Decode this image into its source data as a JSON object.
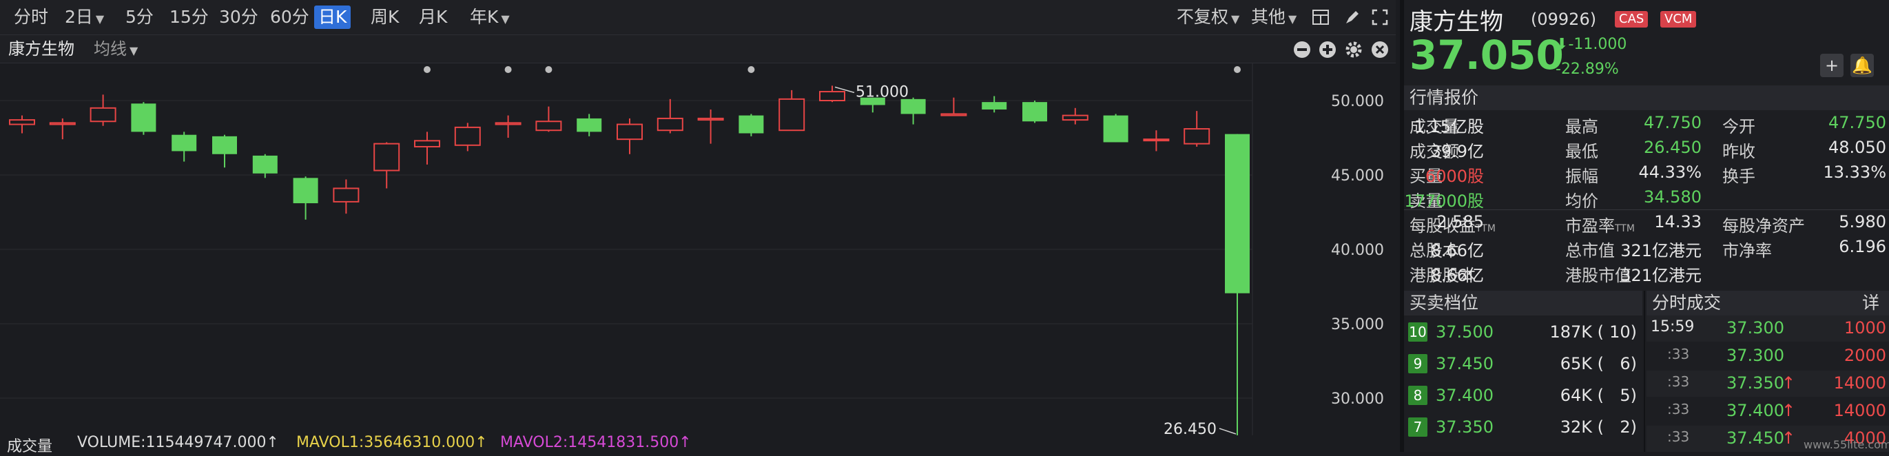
{
  "toolbar": {
    "periods": [
      "分时",
      "2日",
      "5分",
      "15分",
      "30分",
      "60分",
      "日K",
      "周K",
      "月K",
      "年K"
    ],
    "active_period": "日K",
    "adjust": "不复权",
    "other": "其他"
  },
  "subbar": {
    "name": "康方生物",
    "ma_label": "均线"
  },
  "chart_data": {
    "type": "candlestick",
    "ylim": [
      27.5,
      52.5
    ],
    "yticks": [
      "50.000",
      "45.000",
      "40.000",
      "35.000",
      "30.000"
    ],
    "annotations": {
      "high_label": "51.000",
      "low_label": "26.450"
    },
    "candles": [
      {
        "o": 48.4,
        "c": 48.7,
        "h": 49.0,
        "l": 47.8
      },
      {
        "o": 48.4,
        "c": 48.5,
        "h": 48.8,
        "l": 47.4
      },
      {
        "o": 48.6,
        "c": 49.5,
        "h": 50.4,
        "l": 48.3
      },
      {
        "o": 49.8,
        "c": 47.9,
        "h": 49.9,
        "l": 47.7
      },
      {
        "o": 47.7,
        "c": 46.6,
        "h": 47.9,
        "l": 45.9
      },
      {
        "o": 47.6,
        "c": 46.4,
        "h": 47.7,
        "l": 45.5
      },
      {
        "o": 46.3,
        "c": 45.1,
        "h": 46.4,
        "l": 44.8
      },
      {
        "o": 44.8,
        "c": 43.1,
        "h": 44.9,
        "l": 42.0
      },
      {
        "o": 43.2,
        "c": 44.1,
        "h": 44.7,
        "l": 42.4
      },
      {
        "o": 45.3,
        "c": 47.1,
        "h": 47.2,
        "l": 44.1
      },
      {
        "o": 46.9,
        "c": 47.3,
        "h": 47.9,
        "l": 45.7
      },
      {
        "o": 47.0,
        "c": 48.2,
        "h": 48.5,
        "l": 46.6
      },
      {
        "o": 48.4,
        "c": 48.5,
        "h": 49.0,
        "l": 47.5
      },
      {
        "o": 48.0,
        "c": 48.6,
        "h": 49.6,
        "l": 47.9
      },
      {
        "o": 48.8,
        "c": 47.9,
        "h": 49.1,
        "l": 47.6
      },
      {
        "o": 47.4,
        "c": 48.4,
        "h": 48.8,
        "l": 46.4
      },
      {
        "o": 48.0,
        "c": 48.8,
        "h": 50.1,
        "l": 47.8
      },
      {
        "o": 48.7,
        "c": 48.8,
        "h": 49.4,
        "l": 47.1
      },
      {
        "o": 49.0,
        "c": 47.8,
        "h": 49.1,
        "l": 47.6
      },
      {
        "o": 48.0,
        "c": 50.1,
        "h": 50.7,
        "l": 48.0
      },
      {
        "o": 50.0,
        "c": 50.6,
        "h": 51.0,
        "l": 49.9
      },
      {
        "o": 50.2,
        "c": 49.7,
        "h": 50.2,
        "l": 49.2
      },
      {
        "o": 50.1,
        "c": 49.1,
        "h": 50.2,
        "l": 48.4
      },
      {
        "o": 49.0,
        "c": 49.1,
        "h": 50.2,
        "l": 49.0
      },
      {
        "o": 49.9,
        "c": 49.4,
        "h": 50.3,
        "l": 49.2
      },
      {
        "o": 49.9,
        "c": 48.6,
        "h": 50.0,
        "l": 48.5
      },
      {
        "o": 48.7,
        "c": 49.0,
        "h": 49.5,
        "l": 48.4
      },
      {
        "o": 49.0,
        "c": 47.2,
        "h": 49.1,
        "l": 47.2
      },
      {
        "o": 47.4,
        "c": 47.4,
        "h": 48.0,
        "l": 46.6
      },
      {
        "o": 47.1,
        "c": 48.1,
        "h": 49.3,
        "l": 46.9
      },
      {
        "o": 47.75,
        "c": 37.05,
        "h": 47.75,
        "l": 26.45
      }
    ],
    "dot_indices": [
      10,
      12,
      13,
      18,
      30
    ]
  },
  "volume": {
    "label": "成交量",
    "volume_text": "VOLUME:115449747.000↑",
    "mavol1_text": "MAVOL1:35646310.000↑",
    "mavol2_text": "MAVOL2:14541831.500↑"
  },
  "quote": {
    "name": "康方生物",
    "code": "(09926)",
    "badges": [
      "CAS",
      "VCM"
    ],
    "price": "37.050",
    "change": "-11.000",
    "change_pct": "-22.89%",
    "section_title": "行情报价",
    "rows": [
      [
        [
          "成交量",
          "1.15亿股",
          "w"
        ],
        [
          "最高",
          "47.750",
          "g"
        ],
        [
          "今开",
          "47.750",
          "g"
        ]
      ],
      [
        [
          "成交额",
          "39.9亿",
          "w"
        ],
        [
          "最低",
          "26.450",
          "g"
        ],
        [
          "昨收",
          "48.050",
          "w"
        ]
      ],
      [
        [
          "买量",
          "6000股",
          "r"
        ],
        [
          "振幅",
          "44.33%",
          "w"
        ],
        [
          "换手",
          "13.33%",
          "w"
        ]
      ],
      [
        [
          "卖量",
          "177000股",
          "g"
        ],
        [
          "均价",
          "34.580",
          "g"
        ],
        [
          "",
          ""
        ]
      ]
    ],
    "rows2": [
      [
        [
          "每股收益",
          "TTM",
          "2.585"
        ],
        [
          "市盈率",
          "TTM",
          "14.33"
        ],
        [
          "每股净资产",
          "",
          "5.980"
        ]
      ],
      [
        [
          "总股本",
          "",
          "8.66亿"
        ],
        [
          "总市值",
          "",
          "321亿港元"
        ],
        [
          "市净率",
          "",
          "6.196"
        ]
      ],
      [
        [
          "港股股本",
          "",
          "8.66亿"
        ],
        [
          "港股市值",
          "",
          "321亿港元"
        ],
        [
          "",
          ""
        ]
      ]
    ]
  },
  "orderbook": {
    "title": "买卖档位",
    "levels": [
      {
        "lvl": "10",
        "price": "37.500",
        "vol": "187K (",
        "cnt": "10)"
      },
      {
        "lvl": "9",
        "price": "37.450",
        "vol": "65K (",
        "cnt": "6)"
      },
      {
        "lvl": "8",
        "price": "37.400",
        "vol": "64K (",
        "cnt": "5)"
      },
      {
        "lvl": "7",
        "price": "37.350",
        "vol": "32K (",
        "cnt": "2)"
      }
    ]
  },
  "ticks": {
    "title": "分时成交",
    "detail": "详",
    "rows": [
      {
        "time": "15:59",
        "price": "37.300",
        "arrow": "",
        "vol": "1000"
      },
      {
        "time": ":33",
        "price": "37.300",
        "arrow": "",
        "vol": "2000"
      },
      {
        "time": ":33",
        "price": "37.350",
        "arrow": "↑",
        "vol": "14000"
      },
      {
        "time": ":33",
        "price": "37.400",
        "arrow": "↑",
        "vol": "14000"
      },
      {
        "time": ":33",
        "price": "37.450",
        "arrow": "↑",
        "vol": "4000"
      }
    ]
  },
  "watermark": "www.55lite.com"
}
